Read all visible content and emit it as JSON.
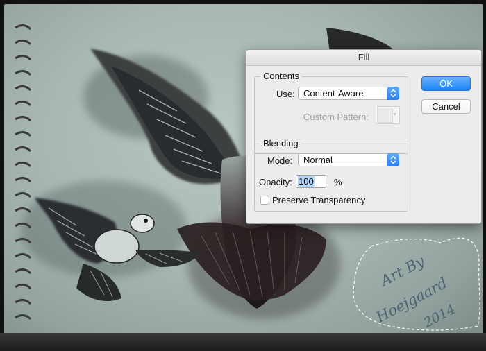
{
  "dialog": {
    "title": "Fill",
    "contents": {
      "group_label": "Contents",
      "use_label": "Use:",
      "use_value": "Content-Aware",
      "custom_pattern_label": "Custom Pattern:"
    },
    "blending": {
      "group_label": "Blending",
      "mode_label": "Mode:",
      "mode_value": "Normal",
      "opacity_label": "Opacity:",
      "opacity_value": "100",
      "opacity_unit": "%",
      "preserve_label": "Preserve Transparency",
      "preserve_checked": false
    },
    "buttons": {
      "ok": "OK",
      "cancel": "Cancel"
    }
  },
  "artwork": {
    "signature_lines": [
      "Art By",
      "Hoejgaard",
      "2014"
    ]
  },
  "colors": {
    "accent": "#2d7ff5",
    "dialog_bg": "#ececec",
    "paper": "#b2c0bd"
  }
}
